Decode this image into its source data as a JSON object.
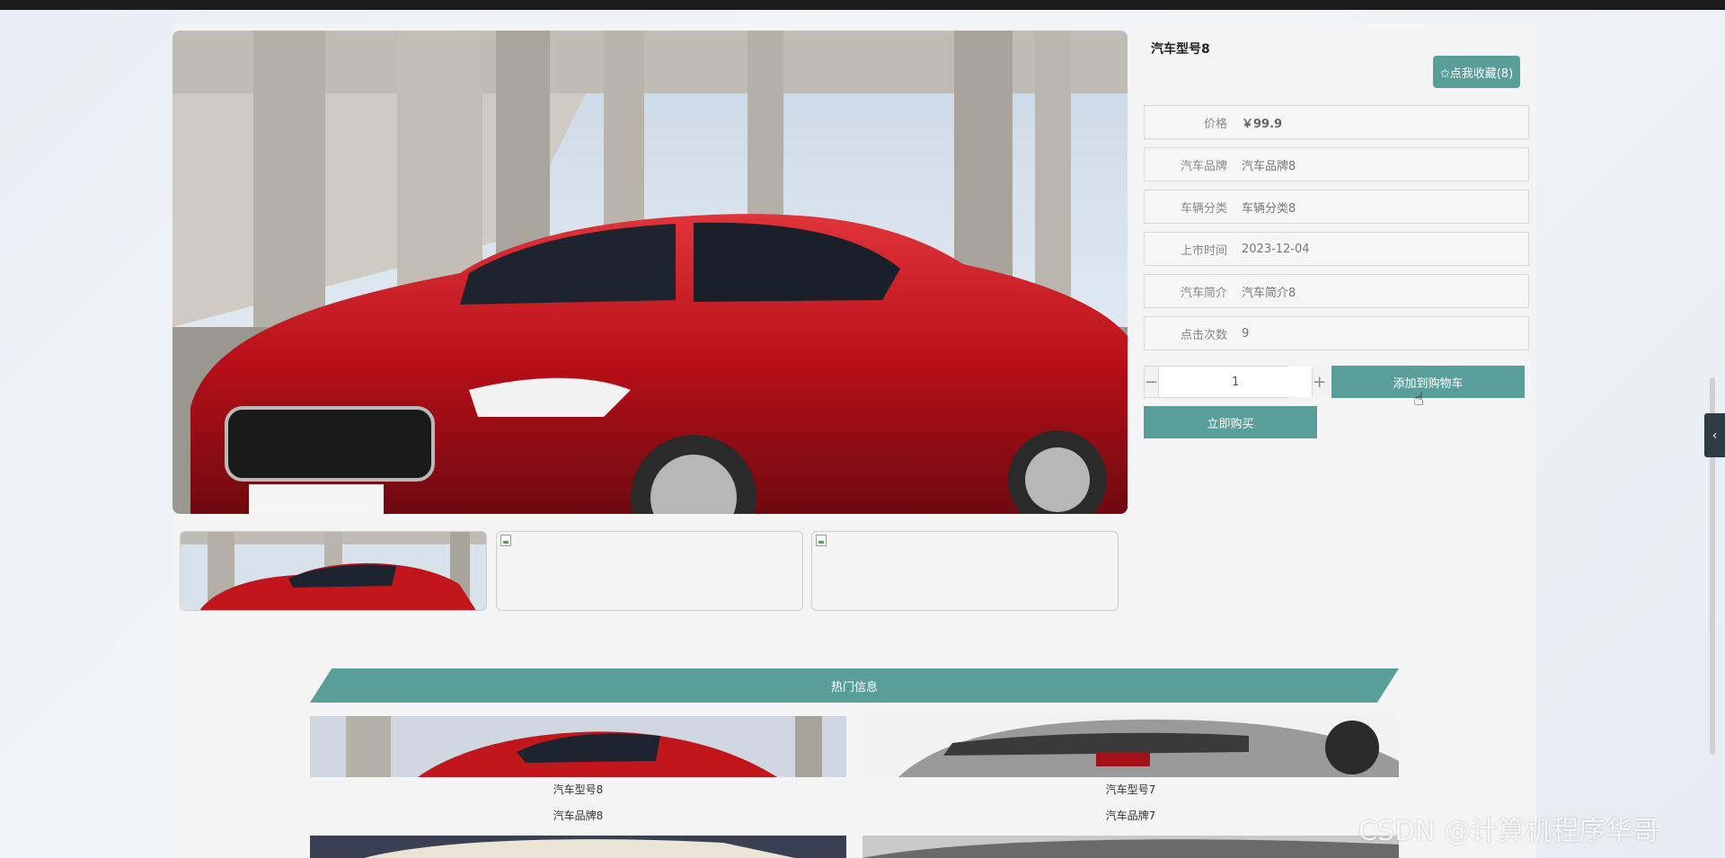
{
  "product": {
    "title": "汽车型号8",
    "favorite_label": "✩点我收藏(8)",
    "details": [
      {
        "key": "价格",
        "value": "￥99.9"
      },
      {
        "key": "汽车品牌",
        "value": "汽车品牌8"
      },
      {
        "key": "车辆分类",
        "value": "车辆分类8"
      },
      {
        "key": "上市时间",
        "value": "2023-12-04"
      },
      {
        "key": "汽车简介",
        "value": "汽车简介8"
      },
      {
        "key": "点击次数",
        "value": "9"
      }
    ],
    "quantity": "1",
    "minus": "−",
    "plus": "+",
    "add_to_cart": "添加到购物车",
    "buy_now": "立即购买"
  },
  "hot": {
    "title": "热门信息",
    "items": [
      {
        "name": "汽车型号8",
        "brand": "汽车品牌8"
      },
      {
        "name": "汽车型号7",
        "brand": "汽车品牌7"
      }
    ]
  },
  "side_tab_icon": "‹",
  "watermark": "CSDN @计算机程序华哥",
  "colors": {
    "accent": "#5a9e9a",
    "car_red": "#c0161c",
    "background": "#f4f4f4"
  }
}
